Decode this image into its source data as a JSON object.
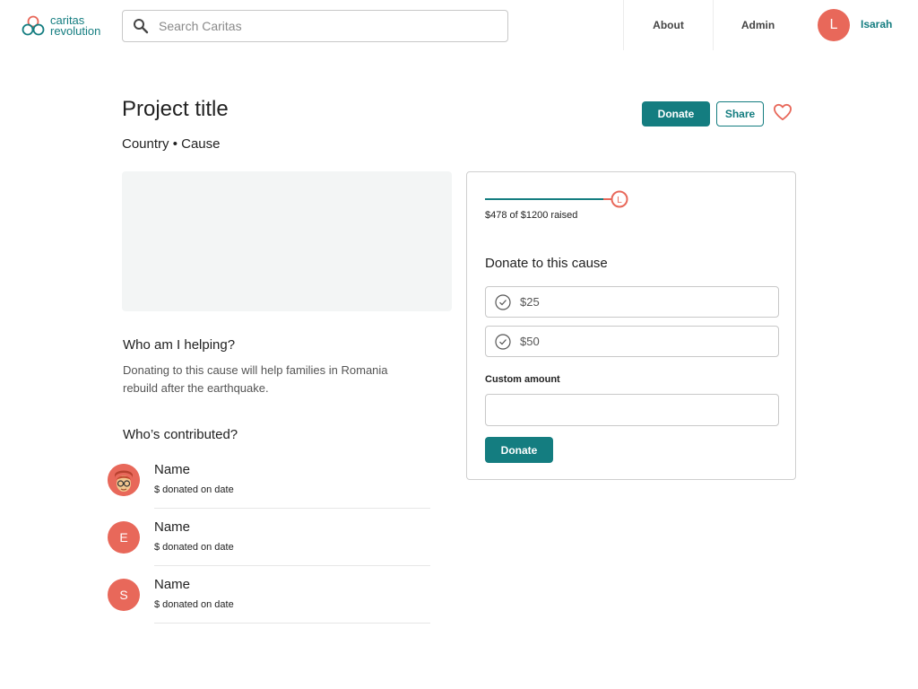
{
  "header": {
    "logo": {
      "line1": "caritas",
      "line2": "revolution"
    },
    "search": {
      "placeholder": "Search Caritas"
    },
    "nav": {
      "about": "About",
      "admin": "Admin"
    },
    "user": {
      "initial": "L",
      "name": "Isarah"
    }
  },
  "project": {
    "title": "Project title",
    "subtitle": "Country • Cause",
    "donate_label": "Donate",
    "share_label": "Share"
  },
  "helping": {
    "heading": "Who am I helping?",
    "text": "Donating to this cause will help families in Romania rebuild after the earthquake."
  },
  "contributors": {
    "heading": "Who’s contributed?",
    "items": [
      {
        "initial": "",
        "name": "Name",
        "desc": "$ donated on date"
      },
      {
        "initial": "E",
        "name": "Name",
        "desc": "$ donated on date"
      },
      {
        "initial": "S",
        "name": "Name",
        "desc": "$ donated on date"
      }
    ]
  },
  "donation": {
    "raised_text": "$478 of $1200 raised",
    "progress_raised": 478,
    "progress_goal": 1200,
    "marker_initial": "L",
    "heading": "Donate to this cause",
    "amounts": [
      "$25",
      "$50"
    ],
    "custom_label": "Custom amount",
    "custom_value": "",
    "donate_label": "Donate"
  },
  "colors": {
    "brand_teal": "#147d80",
    "accent_coral": "#e8685a"
  }
}
